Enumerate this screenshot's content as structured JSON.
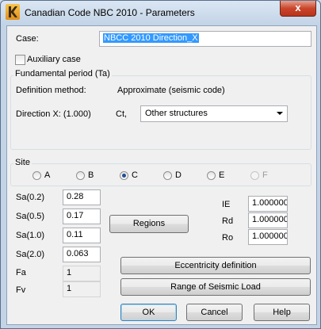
{
  "window": {
    "title": "Canadian Code NBC 2010 - Parameters",
    "close_label": "x"
  },
  "case": {
    "label": "Case:",
    "value": "NBCC 2010 Direction_X"
  },
  "auxiliary": {
    "label": "Auxiliary case",
    "checked": false
  },
  "fundamental": {
    "title": "Fundamental period (Ta)",
    "definition_label": "Definition method:",
    "definition_value": "Approximate (seismic code)",
    "direction_label": "Direction X: (1.000)",
    "ct_label": "Ct,",
    "ct_value": "Other structures"
  },
  "site": {
    "title": "Site",
    "options": [
      {
        "label": "A",
        "selected": false,
        "enabled": true
      },
      {
        "label": "B",
        "selected": false,
        "enabled": true
      },
      {
        "label": "C",
        "selected": true,
        "enabled": true
      },
      {
        "label": "D",
        "selected": false,
        "enabled": true
      },
      {
        "label": "E",
        "selected": false,
        "enabled": true
      },
      {
        "label": "F",
        "selected": false,
        "enabled": false
      }
    ]
  },
  "params": {
    "sa02_label": "Sa(0.2)",
    "sa02_value": "0.28",
    "sa05_label": "Sa(0.5)",
    "sa05_value": "0.17",
    "sa10_label": "Sa(1.0)",
    "sa10_value": "0.11",
    "sa20_label": "Sa(2.0)",
    "sa20_value": "0.063",
    "fa_label": "Fa",
    "fa_value": "1",
    "fv_label": "Fv",
    "fv_value": "1"
  },
  "factors": {
    "ie_label": "IE",
    "ie_value": "1.000000",
    "rd_label": "Rd",
    "rd_value": "1.000000",
    "ro_label": "Ro",
    "ro_value": "1.000000"
  },
  "buttons": {
    "regions": "Regions",
    "eccentricity": "Eccentricity definition",
    "range": "Range of Seismic Load",
    "ok": "OK",
    "cancel": "Cancel",
    "help": "Help"
  }
}
